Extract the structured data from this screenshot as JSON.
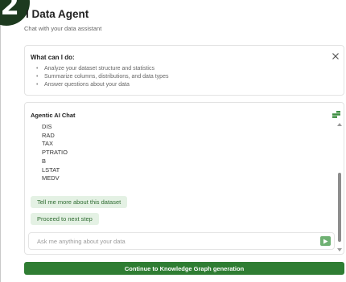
{
  "step": {
    "number": "2"
  },
  "app": {
    "title": "I Data Agent",
    "subtitle": "Chat with your data assistant"
  },
  "info_panel": {
    "heading": "What can I do:",
    "close_icon": "close-icon",
    "items": [
      "Analyze your dataset structure and statistics",
      "Summarize columns, distributions, and data types",
      "Answer questions about your data"
    ]
  },
  "chat": {
    "title": "Agentic AI Chat",
    "menu_icon": "chat-menu-icon",
    "lines": [
      "DIS",
      "RAD",
      "TAX",
      "PTRATIO",
      "B",
      "LSTAT",
      "MEDV"
    ],
    "suggestions": [
      "Tell me more about this dataset",
      "Proceed to next step"
    ],
    "input": {
      "value": "",
      "placeholder": "Ask me anything about your data"
    },
    "send_icon": "send-arrow-icon"
  },
  "footer": {
    "continue_label": "Continue to Knowledge Graph generation"
  },
  "colors": {
    "accent": "#2f7d33",
    "suggestion_bg": "#e4f1e4",
    "suggestion_text": "#2e6b31",
    "badge": "#1d3a1f"
  }
}
